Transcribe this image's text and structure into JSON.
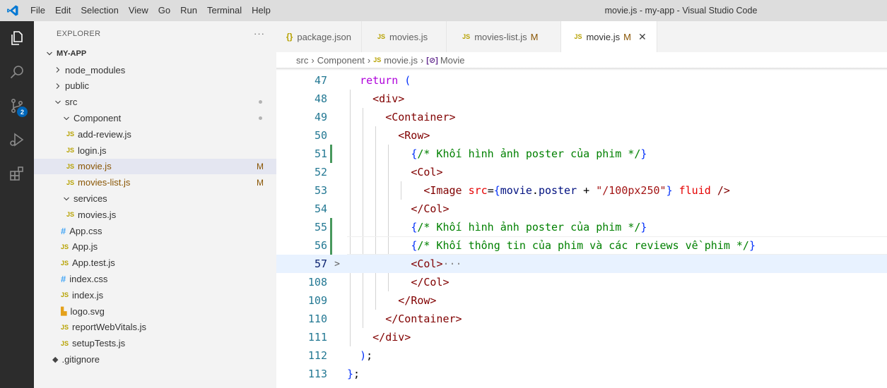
{
  "titlebar": {
    "menu": [
      "File",
      "Edit",
      "Selection",
      "View",
      "Go",
      "Run",
      "Terminal",
      "Help"
    ],
    "window_title": "movie.js - my-app - Visual Studio Code"
  },
  "activity": {
    "scm_badge": "2"
  },
  "explorer": {
    "header": "EXPLORER",
    "more": "···",
    "root": "MY-APP",
    "items": [
      {
        "label": "node_modules",
        "type": "folder",
        "open": false,
        "depth": 1
      },
      {
        "label": "public",
        "type": "folder",
        "open": false,
        "depth": 1
      },
      {
        "label": "src",
        "type": "folder",
        "open": true,
        "depth": 1
      },
      {
        "label": "Component",
        "type": "folder",
        "open": true,
        "depth": 2
      },
      {
        "label": "add-review.js",
        "type": "js",
        "depth": 3
      },
      {
        "label": "login.js",
        "type": "js",
        "depth": 3
      },
      {
        "label": "movie.js",
        "type": "js",
        "depth": 3,
        "badge": "M"
      },
      {
        "label": "movies-list.js",
        "type": "js",
        "depth": 3,
        "badge": "M"
      },
      {
        "label": "services",
        "type": "folder",
        "open": true,
        "depth": 2
      },
      {
        "label": "movies.js",
        "type": "js",
        "depth": 3
      },
      {
        "label": "App.css",
        "type": "css",
        "depth": 2
      },
      {
        "label": "App.js",
        "type": "js",
        "depth": 2
      },
      {
        "label": "App.test.js",
        "type": "js",
        "depth": 2
      },
      {
        "label": "index.css",
        "type": "css",
        "depth": 2
      },
      {
        "label": "index.js",
        "type": "js",
        "depth": 2
      },
      {
        "label": "logo.svg",
        "type": "svg",
        "depth": 2
      },
      {
        "label": "reportWebVitals.js",
        "type": "js",
        "depth": 2
      },
      {
        "label": "setupTests.js",
        "type": "js",
        "depth": 2
      },
      {
        "label": ".gitignore",
        "type": "git",
        "depth": 1
      }
    ]
  },
  "tabs": [
    {
      "label": "package.json",
      "icon": "{}",
      "modified": ""
    },
    {
      "label": "movies.js",
      "icon": "JS",
      "modified": ""
    },
    {
      "label": "movies-list.js",
      "icon": "JS",
      "modified": "M"
    },
    {
      "label": "movie.js",
      "icon": "JS",
      "modified": "M",
      "active": true,
      "close": "✕"
    }
  ],
  "breadcrumbs": {
    "parts": [
      "src",
      "Component",
      "movie.js",
      "Movie"
    ],
    "js_icon": "JS",
    "symbol_icon": "[⊘]"
  },
  "editor": {
    "lines": [
      {
        "num": "47",
        "code": "return ("
      },
      {
        "num": "48",
        "code": "<div>"
      },
      {
        "num": "49",
        "code": "<Container>"
      },
      {
        "num": "50",
        "code": "<Row>"
      },
      {
        "num": "51",
        "code": "{/* Khối hình ảnh poster của phim */}"
      },
      {
        "num": "52",
        "code": "<Col>"
      },
      {
        "num": "53",
        "code": "<Image src={movie.poster + \"/100px250\"} fluid />"
      },
      {
        "num": "54",
        "code": "</Col>"
      },
      {
        "num": "55",
        "code": "{/* Khối hình ảnh poster của phim */}"
      },
      {
        "num": "56",
        "code": "{/* Khối thông tin của phim và các reviews về phim */}"
      },
      {
        "num": "57",
        "code": "<Col>···"
      },
      {
        "num": "108",
        "code": "</Col>"
      },
      {
        "num": "109",
        "code": "</Row>"
      },
      {
        "num": "110",
        "code": "</Container>"
      },
      {
        "num": "111",
        "code": "</div>"
      },
      {
        "num": "112",
        "code": ");"
      },
      {
        "num": "113",
        "code": "};"
      }
    ],
    "fold_marker": ">"
  },
  "colors": {
    "activity_bar": "#2c2c2c",
    "sidebar": "#f3f3f3",
    "selected_row": "#e4e6f1",
    "git_modified": "#895503",
    "gutter_added": "#48985d",
    "current_line": "#e8f2ff"
  }
}
